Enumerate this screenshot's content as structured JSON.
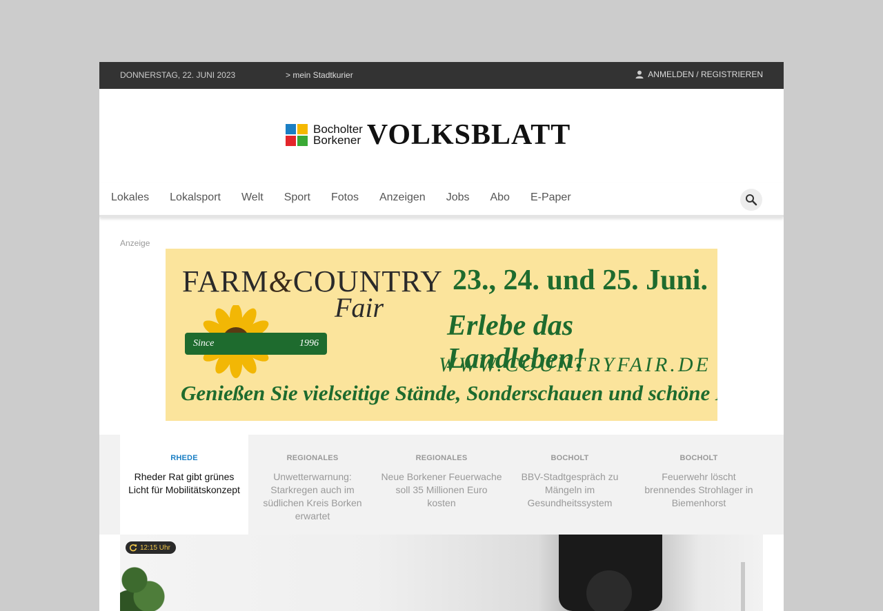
{
  "topbar": {
    "date": "DONNERSTAG, 22. JUNI 2023",
    "mein_link": "> mein Stadtkurier",
    "login": "ANMELDEN / REGISTRIEREN"
  },
  "logo": {
    "line1": "Bocholter",
    "line2": "Borkener",
    "brand": "VOLKSBLATT",
    "square_colors": [
      "#1b7fc4",
      "#f5b800",
      "#e3262b",
      "#3aa935"
    ]
  },
  "nav": {
    "items": [
      "Lokales",
      "Lokalsport",
      "Welt",
      "Sport",
      "Fotos",
      "Anzeigen",
      "Jobs",
      "Abo",
      "E-Paper"
    ]
  },
  "ad": {
    "label": "Anzeige",
    "farm_text": "FARM",
    "amp": "&",
    "country_text": "COUNTRY",
    "fair": "Fair",
    "since": "Since",
    "year": "1996",
    "dates": "23., 24. und 25. Juni.",
    "slogan": "Erlebe das Landleben!",
    "url": "WWW.COUNTRYFAIR.DE",
    "bottom": "Genießen Sie vielseitige Stände, Sonderschauen und schöne Musik."
  },
  "teasers": [
    {
      "category": "RHEDE",
      "title": "Rheder Rat gibt grünes Licht für Mobilitätskonzept",
      "active": true
    },
    {
      "category": "REGIONALES",
      "title": "Unwetterwarnung: Starkregen auch im südlichen Kreis Borken erwartet",
      "active": false
    },
    {
      "category": "REGIONALES",
      "title": "Neue Borkener Feuerwache soll 35 Millionen Euro kosten",
      "active": false
    },
    {
      "category": "BOCHOLT",
      "title": "BBV-Stadtgespräch zu Mängeln im Gesundheitssystem",
      "active": false
    },
    {
      "category": "BOCHOLT",
      "title": "Feuerwehr löscht brennendes Strohlager in Biemenhorst",
      "active": false
    }
  ],
  "hero": {
    "time_badge": "12:15 Uhr"
  },
  "colors": {
    "accent": "#1b7fc4",
    "topbar": "#333333",
    "ad_green": "#1e6b2e",
    "ad_background": "#fbe49c"
  }
}
